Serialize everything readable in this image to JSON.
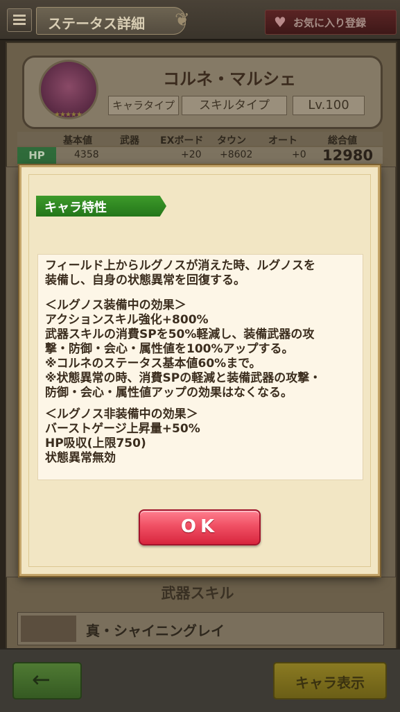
{
  "header": {
    "title": "ステータス詳細",
    "favorite_label": "お気に入り登録"
  },
  "character": {
    "name": "コルネ・マルシェ",
    "chara_type_label": "キャラタイプ",
    "skill_type_label": "スキルタイプ",
    "level": "Lv.100",
    "stars": "★★★★★"
  },
  "stats": {
    "headers": [
      "基本値",
      "武器",
      "EXボード",
      "タウン",
      "オート",
      "総合値"
    ],
    "hp": {
      "label": "HP",
      "base": "4358",
      "weapon": "",
      "ex_board": "+20",
      "town": "+8602",
      "auto": "+0",
      "total": "12980"
    }
  },
  "weapon_skill": {
    "section_title": "武器スキル",
    "name": "真・シャイニングレイ"
  },
  "footer": {
    "back_label": "←",
    "chara_view_label": "キャラ表示"
  },
  "dialog": {
    "title": "キャラ特性",
    "lines": [
      "フィールド上からルグノスが消えた時、ルグノスを",
      "装備し、自身の状態異常を回復する。",
      "",
      "＜ルグノス装備中の効果＞",
      "アクションスキル強化+800%",
      "武器スキルの消費SPを50%軽減し、装備武器の攻",
      "撃・防御・会心・属性値を100%アップする。",
      "※コルネのステータス基本値60%まで。",
      "※状態異常の時、消費SPの軽減と装備武器の攻撃・",
      "防御・会心・属性値アップの効果はなくなる。",
      "",
      "＜ルグノス非装備中の効果＞",
      "バーストゲージ上昇量+50%",
      "HP吸収(上限750)",
      "状態異常無効"
    ],
    "ok_label": "OK"
  },
  "colors": {
    "dialog_bg": "#f2e6c4",
    "title_green": "#2f8a22",
    "ok_red": "#f05064"
  }
}
